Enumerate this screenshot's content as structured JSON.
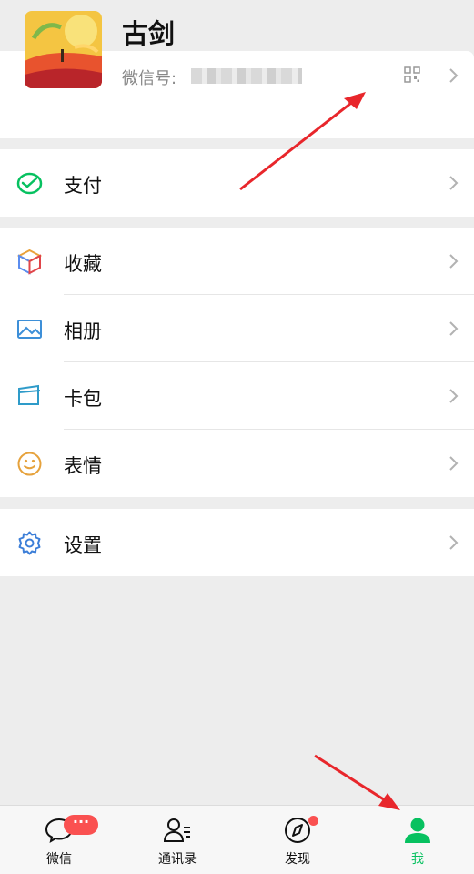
{
  "profile": {
    "nickname": "古剑",
    "wechat_id_label": "微信号:"
  },
  "menu": {
    "pay": {
      "label": "支付",
      "icon": "wallet-icon"
    },
    "favorites": {
      "label": "收藏",
      "icon": "cube-icon"
    },
    "album": {
      "label": "相册",
      "icon": "image-icon"
    },
    "cards": {
      "label": "卡包",
      "icon": "card-icon"
    },
    "stickers": {
      "label": "表情",
      "icon": "smiley-icon"
    },
    "settings": {
      "label": "设置",
      "icon": "gear-icon"
    }
  },
  "tabbar": {
    "chats": {
      "label": "微信",
      "badge": "···"
    },
    "contacts": {
      "label": "通讯录"
    },
    "discover": {
      "label": "发现"
    },
    "me": {
      "label": "我"
    }
  },
  "colors": {
    "accent_green": "#07c160",
    "badge_red": "#fa5151",
    "annotation_red": "#e8262b"
  }
}
